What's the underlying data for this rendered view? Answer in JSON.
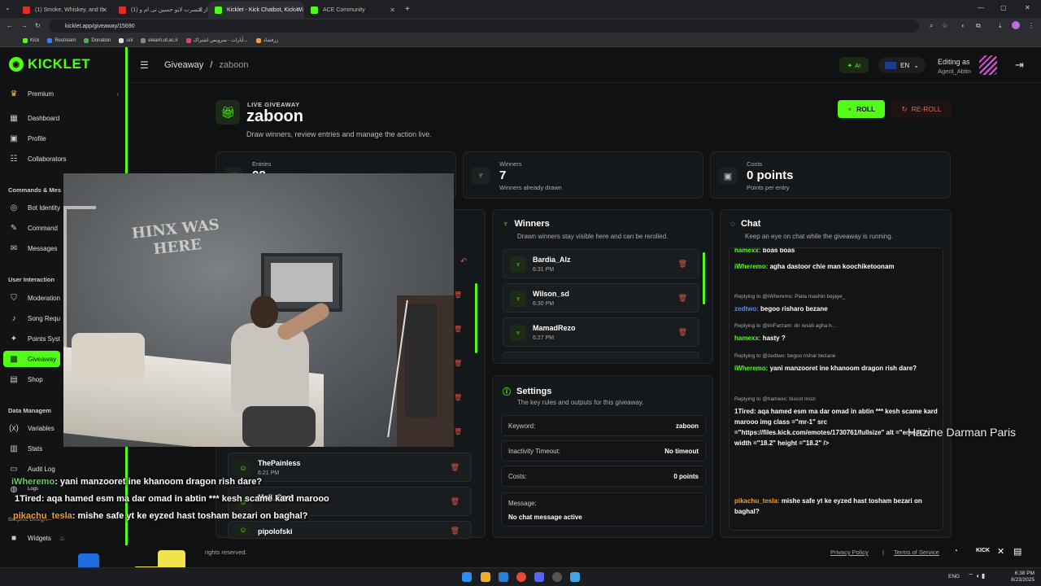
{
  "browser": {
    "tabs": [
      {
        "label": "(1) Smoke, Whiskey, and th",
        "color": "#e52d27"
      },
      {
        "label": "(1) از کنسرت لایو حسین تی ام و",
        "color": "#e52d27"
      },
      {
        "label": "Kicklet - Kick Chatbot, Kick Wi",
        "color": "#53fc18"
      },
      {
        "label": "ACE Community",
        "color": "#53fc18"
      }
    ],
    "url": "kicklet.app/giveaway/15690",
    "bookmarks": [
      "Kick",
      "Restream",
      "Donation",
      "uni",
      "elearn.ut.ac.ir",
      "آپارات - سرویس اشتراک...",
      "ژرفشاد"
    ]
  },
  "sidebar": {
    "brand": "KICKLET",
    "premium": "Premium",
    "items_top": [
      "Dashboard",
      "Profile",
      "Collaborators"
    ],
    "section_commands": "Commands & Mes",
    "items_commands": [
      "Bot Identity",
      "Command",
      "Messages"
    ],
    "section_user": "User Interaction",
    "items_user": [
      "Moderation",
      "Song Requ",
      "Points Syst",
      "Giveaway",
      "Shop"
    ],
    "section_data": "Data Managem",
    "items_data": [
      "Variables",
      "Stats",
      "Audit Log",
      "Logs"
    ],
    "section_graphic": "Graphic Design",
    "items_graphic": [
      "Widgets"
    ]
  },
  "header": {
    "breadcrumb_root": "Giveaway",
    "breadcrumb_sep": "/",
    "breadcrumb_current": "zaboon",
    "ai_label": "AI",
    "lang": "EN",
    "editing_label": "Editing as",
    "editing_user": "Agent_Abtin"
  },
  "giveaway": {
    "tag": "LIVE GIVEAWAY",
    "title": "zaboon",
    "description": "Draw winners, review entries and manage the action live.",
    "roll_label": "ROLL",
    "reroll_label": "RE-ROLL"
  },
  "stats": {
    "entries": {
      "label": "Entries",
      "value": "28"
    },
    "winners": {
      "label": "Winners",
      "value": "7",
      "sub": "Winners already drawn"
    },
    "costs": {
      "label": "Costs",
      "value": "0 points",
      "sub": "Points per entry"
    }
  },
  "entries_list": [
    {
      "name": "ThePainless",
      "time": "6:21 PM"
    },
    {
      "name": "Moll_Cool",
      "time": ""
    },
    {
      "name": "pipolofski",
      "time": ""
    }
  ],
  "winners_panel": {
    "title": "Winners",
    "subtitle": "Drawn winners stay visible here and can be rerolled.",
    "items": [
      {
        "name": "Bardia_Alz",
        "time": "6:31 PM"
      },
      {
        "name": "Wilson_sd",
        "time": "6:30 PM"
      },
      {
        "name": "MamadRezo",
        "time": "6:27 PM"
      }
    ]
  },
  "settings_panel": {
    "title": "Settings",
    "subtitle": "The key rules and outputs for this giveaway.",
    "keyword_label": "Keyword:",
    "keyword_value": "zaboon",
    "timeout_label": "Inactivity Timeout:",
    "timeout_value": "No timeout",
    "costs_label": "Costs:",
    "costs_value": "0 points",
    "message_label": "Message:",
    "message_value": "No chat message active"
  },
  "chat_panel": {
    "title": "Chat",
    "subtitle": "Keep an eye on chat while the giveaway is running.",
    "lines": [
      {
        "user": "hamexx:",
        "text": "boas boas",
        "color": "#53fc18"
      },
      {
        "user": "iWheremo:",
        "text": "agha dastoor chie man koochiketoonam",
        "color": "#53fc18"
      },
      {
        "reply": "Replying to @iWheremo: Plata mashin bejaye_"
      },
      {
        "user": "zedtwo:",
        "text": "begoo risharo bezane",
        "color": "#5b8def"
      },
      {
        "reply": "Replying to @imFarzam: dir residi agha h..."
      },
      {
        "user": "hamexx:",
        "text": "hasty ?",
        "color": "#53fc18"
      },
      {
        "reply": "Replying to @zedtwo: begoo rishar bezane"
      },
      {
        "user": "iWheremo:",
        "text": "yani manzooret ine khanoom dragon rish dare?",
        "color": "#53fc18"
      },
      {
        "reply": "Replying to @hamexx: biscot mozi"
      },
      {
        "user": "1Tired:",
        "text": "aqa hamed esm ma dar omad in abtin *** kesh scame kard marooo img class =\"mr-1\" src =\"https://files.kick.com/emotes/1730761/fullsize\" alt =\"emojiCry\" width =\"18.2\" height =\"18.2\" />",
        "color": "#ffffff"
      },
      {
        "user": "pikachu_tesla:",
        "text": "mishe safe yt ke eyzed hast tosham bezari on baghal?",
        "color": "#f39c36"
      }
    ]
  },
  "overlay": {
    "line1_user": "iWheremo",
    "line1_text": ": yani manzooret ine khanoom dragon rish dare?",
    "line2_user": "1Tired",
    "line2_text": ": aqa hamed esm ma dar omad in abtin *** kesh scame kard marooo",
    "line3_user": "pikachu_tesla",
    "line3_text": ": mishe safe yt ke eyzed hast tosham bezari on baghal?",
    "caption": "Hazine Darman Paris",
    "graffiti": "HINX WAS HERE"
  },
  "footer": {
    "rights": "rights reserved.",
    "privacy": "Privacy Policy",
    "sep": "|",
    "terms": "Terms of Service",
    "kick": "KICK"
  },
  "taskbar": {
    "lang": "ENG",
    "time": "6:38 PM",
    "date": "8/23/2025"
  },
  "colors": {
    "accent": "#53fc18",
    "danger": "#e0513f",
    "bg": "#0f1113"
  }
}
